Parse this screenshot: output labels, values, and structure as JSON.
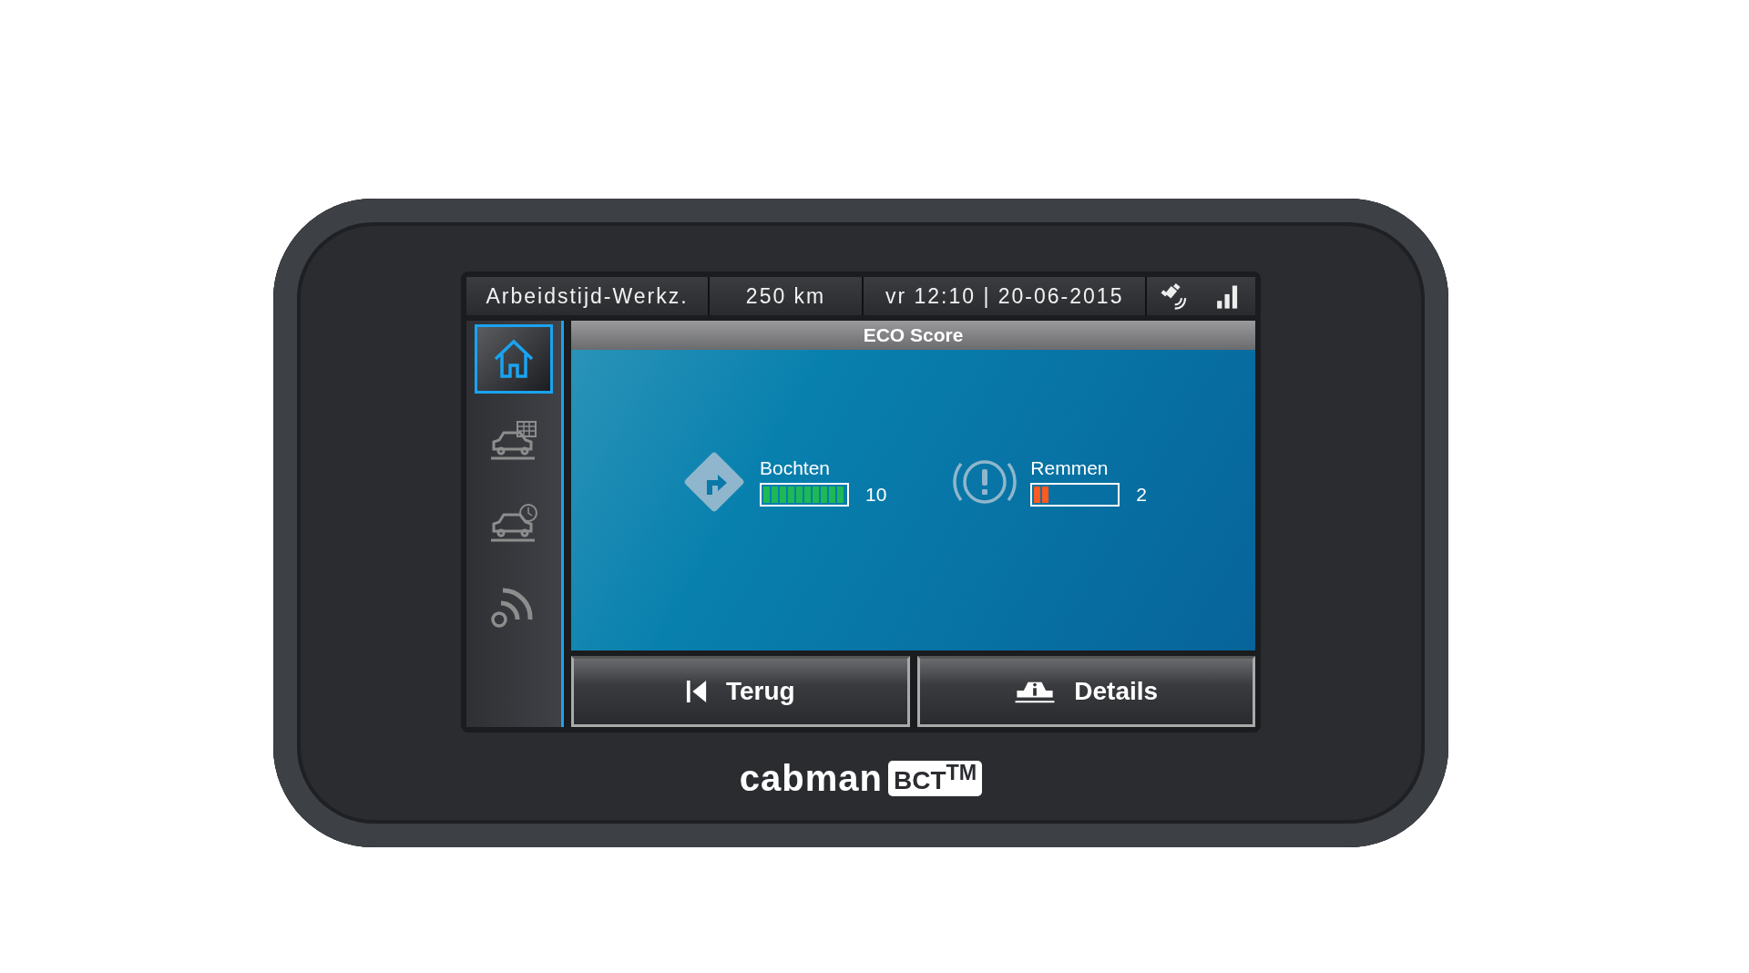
{
  "status_bar": {
    "mode": "Arbeidstijd-Werkz.",
    "distance": "250 km",
    "datetime": "vr 12:10 | 20-06-2015"
  },
  "sidebar": {
    "items": [
      {
        "kind": "home",
        "selected": true
      },
      {
        "kind": "car-table",
        "selected": false
      },
      {
        "kind": "car-clock",
        "selected": false
      },
      {
        "kind": "signal",
        "selected": false
      }
    ]
  },
  "panel": {
    "title": "ECO Score",
    "metrics": [
      {
        "kind": "bends",
        "label": "Bochten",
        "level": 1.0,
        "reading": "10",
        "color": "#1db954"
      },
      {
        "kind": "brakes",
        "label": "Remmen",
        "level": 0.2,
        "reading": "2",
        "color": "#ff5a1f"
      }
    ]
  },
  "buttons": [
    {
      "kind": "back",
      "label": "Terug"
    },
    {
      "kind": "details",
      "label": "Details"
    }
  ],
  "brand": {
    "name": "cabman",
    "badge": "BCT$^{TM}$"
  }
}
